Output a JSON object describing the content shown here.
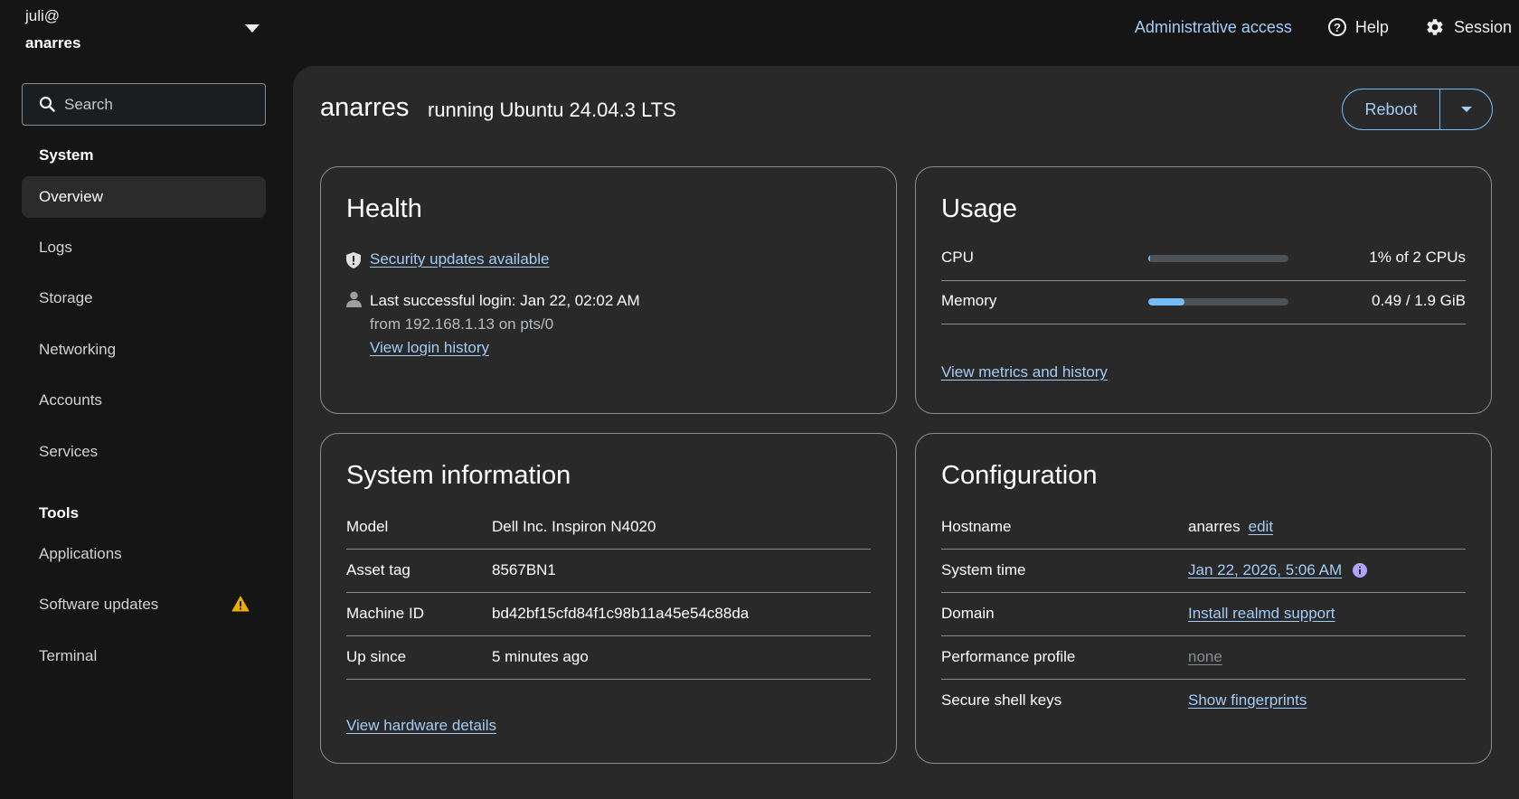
{
  "host_switcher": {
    "user": "juli@",
    "host": "anarres"
  },
  "topbar": {
    "admin_access": "Administrative access",
    "help": "Help",
    "session": "Session"
  },
  "sidebar": {
    "search_placeholder": "Search",
    "system_title": "System",
    "system_items": [
      {
        "label": "Overview",
        "active": true
      },
      {
        "label": "Logs"
      },
      {
        "label": "Storage"
      },
      {
        "label": "Networking"
      },
      {
        "label": "Accounts"
      },
      {
        "label": "Services"
      }
    ],
    "tools_title": "Tools",
    "tools_items": [
      {
        "label": "Applications"
      },
      {
        "label": "Software updates",
        "warning": true
      },
      {
        "label": "Terminal"
      }
    ]
  },
  "page": {
    "host": "anarres",
    "os": "running Ubuntu 24.04.3 LTS",
    "reboot_label": "Reboot"
  },
  "health": {
    "title": "Health",
    "security_link": "Security updates available",
    "last_login": "Last successful login: Jan 22, 02:02 AM",
    "login_from": "from 192.168.1.13 on pts/0",
    "login_history_link": "View login history"
  },
  "usage": {
    "title": "Usage",
    "cpu": {
      "label": "CPU",
      "value": "1% of 2 CPUs",
      "fraction": 0.01
    },
    "memory": {
      "label": "Memory",
      "value": "0.49 / 1.9 GiB",
      "fraction": 0.26
    },
    "metrics_link": "View metrics and history"
  },
  "system_info": {
    "title": "System information",
    "rows": [
      {
        "key": "Model",
        "value": "Dell Inc. Inspiron N4020"
      },
      {
        "key": "Asset tag",
        "value": "8567BN1"
      },
      {
        "key": "Machine ID",
        "value": "bd42bf15cfd84f1c98b11a45e54c88da"
      },
      {
        "key": "Up since",
        "value": "5 minutes ago"
      }
    ],
    "hardware_link": "View hardware details"
  },
  "configuration": {
    "title": "Configuration",
    "hostname_key": "Hostname",
    "hostname_value": "anarres",
    "hostname_edit": "edit",
    "time_key": "System time",
    "time_value": "Jan 22, 2026, 5:06 AM",
    "domain_key": "Domain",
    "domain_value": "Install realmd support",
    "profile_key": "Performance profile",
    "profile_value": "none",
    "ssh_key": "Secure shell keys",
    "ssh_value": "Show fingerprints"
  },
  "colors": {
    "accent": "#73bcf7",
    "link": "#a3cdf6",
    "warning": "#f0ab00",
    "page_bg": "#151515",
    "panel_bg": "#292929"
  }
}
